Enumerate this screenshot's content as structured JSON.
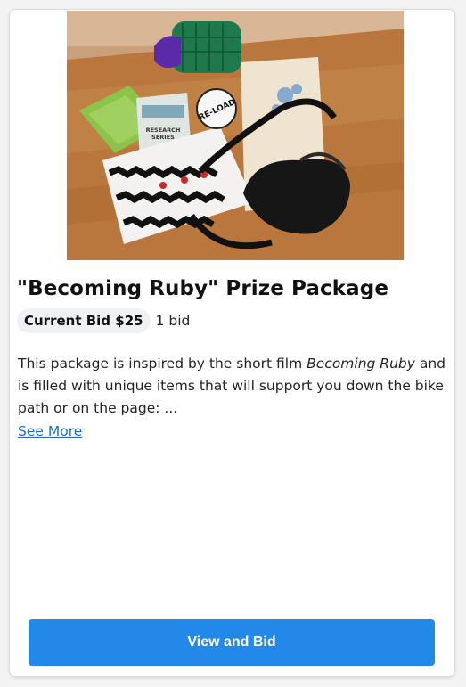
{
  "listing": {
    "title": "\"Becoming Ruby\" Prize Package",
    "current_bid_label": "Current Bid $25",
    "bid_count": "1 bid",
    "description_before": "This package is inspired by the short film ",
    "description_film": "Becoming Ruby",
    "description_after": " and is filled with unique items that will support you down the bike path or on the page: ...",
    "see_more": "See More",
    "cta_label": "View and Bid",
    "image_text": {
      "book_line1": "RESEARCH",
      "book_line2": "SERIES",
      "logo": "RE-LOAD"
    }
  },
  "colors": {
    "accent": "#2389e8",
    "link": "#1a6fc9",
    "pill_bg": "#eef1f6"
  }
}
